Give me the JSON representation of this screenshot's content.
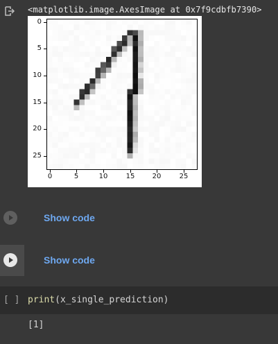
{
  "output": {
    "icon": "output-redirect-icon",
    "repr_text": "<matplotlib.image.AxesImage at 0x7f9cdbfb7390>"
  },
  "plot": {
    "y_ticks": [
      "0",
      "5",
      "10",
      "15",
      "20",
      "25"
    ],
    "x_ticks": [
      "0",
      "5",
      "10",
      "15",
      "20",
      "25"
    ],
    "image_size": 28,
    "colormap": "gray_r",
    "background_level": 0.03,
    "strokes": [
      {
        "from": [
          15,
          2
        ],
        "to": [
          5,
          15
        ],
        "intensity": 0.85
      },
      {
        "from": [
          16,
          2
        ],
        "to": [
          15,
          24
        ],
        "intensity": 0.95
      }
    ]
  },
  "sections": [
    {
      "label": "Show code",
      "icon": "play-icon"
    },
    {
      "label": "Show code",
      "icon": "play-icon"
    }
  ],
  "cell": {
    "brackets": "[ ]",
    "code_fn": "print",
    "code_args": "(x_single_prediction)"
  },
  "cell_output": "[1]",
  "colors": {
    "background": "#383838",
    "cell_background": "#2c2c2c",
    "link_blue": "#6ea8f0",
    "function_yellow": "#dcdcaa"
  }
}
